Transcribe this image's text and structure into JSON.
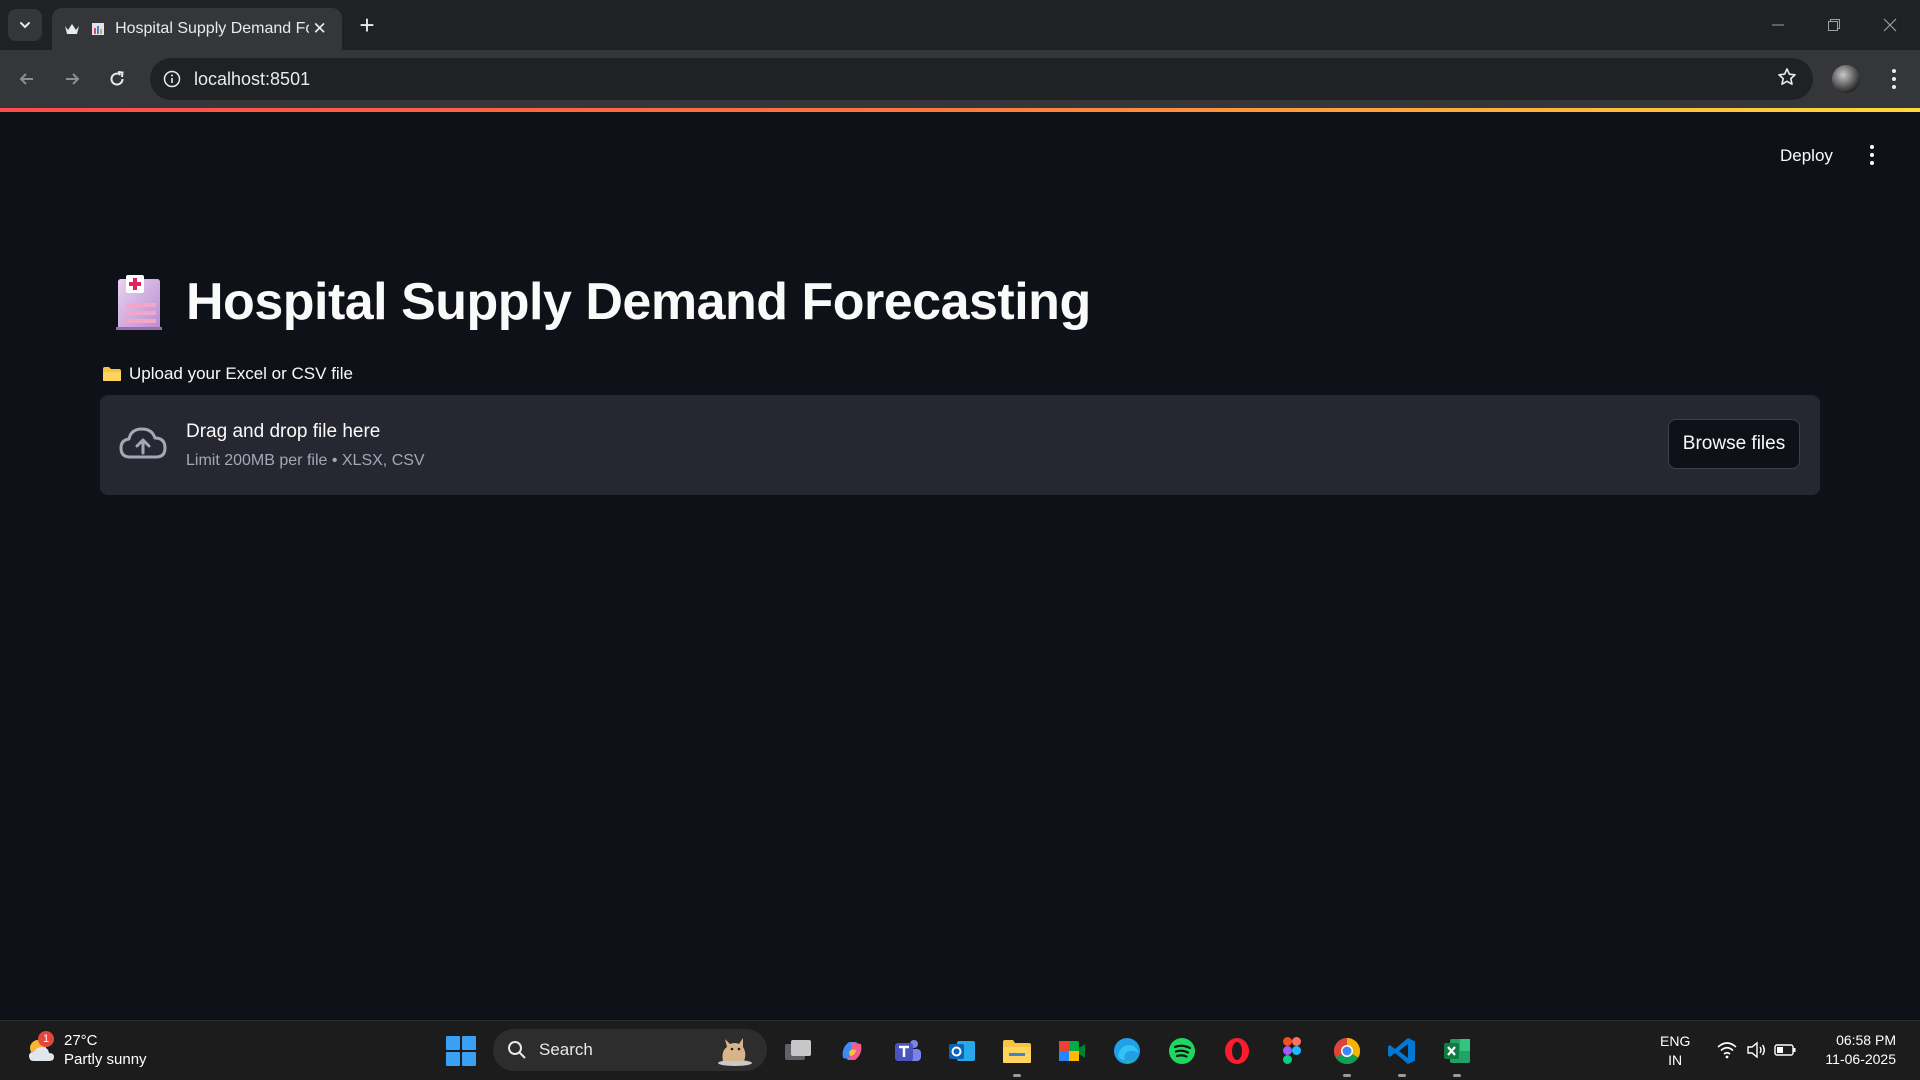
{
  "browser": {
    "tab_title": "Hospital Supply Demand Fo",
    "url": "localhost:8501"
  },
  "app": {
    "deploy_label": "Deploy",
    "title": "Hospital Supply Demand Forecasting",
    "upload_label": "Upload your Excel or CSV file",
    "dropzone_title": "Drag and drop file here",
    "dropzone_subtitle": "Limit 200MB per file • XLSX, CSV",
    "browse_label": "Browse files"
  },
  "taskbar": {
    "weather_temp": "27°C",
    "weather_desc": "Partly sunny",
    "weather_badge": "1",
    "search_label": "Search",
    "lang_top": "ENG",
    "lang_bottom": "IN",
    "time": "06:58 PM",
    "date": "11-06-2025",
    "apps": [
      "task-view-icon",
      "copilot-icon",
      "teams-icon",
      "outlook-icon",
      "file-explorer-icon",
      "meet-icon",
      "edge-icon",
      "spotify-icon",
      "opera-icon",
      "figma-icon",
      "chrome-icon",
      "vscode-icon",
      "excel-icon"
    ]
  },
  "colors": {
    "background": "#0e1117",
    "dropzone": "#262730",
    "accent_gradient_start": "#ff4b4b",
    "accent_gradient_end": "#ffd93d"
  }
}
